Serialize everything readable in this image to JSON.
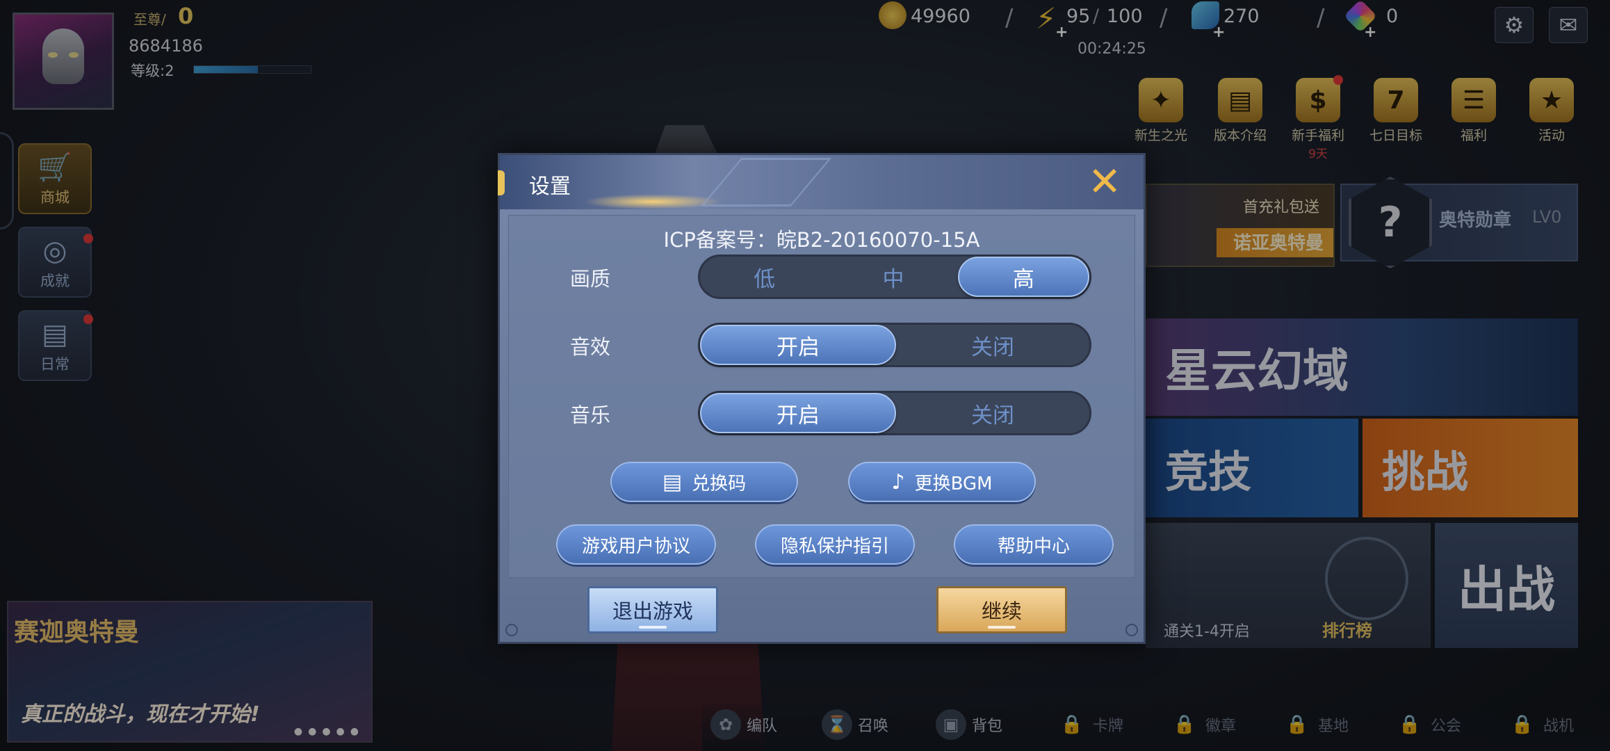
{
  "player": {
    "vip_label": "至尊/",
    "vip_value": "0",
    "id": "8684186",
    "level_label": "等级:2",
    "level_progress": 0.55
  },
  "side_buttons": [
    {
      "label": "商城",
      "icon": "cart-icon"
    },
    {
      "label": "成就",
      "icon": "medal-icon"
    },
    {
      "label": "日常",
      "icon": "daily-icon"
    }
  ],
  "resources": {
    "gold": "49960",
    "energy": "95",
    "energy_max": "100",
    "diamond": "270",
    "gem": "0",
    "timer": "00:24:25"
  },
  "events": [
    {
      "label": "新生之光",
      "icon": "star-burst-icon",
      "sub": ""
    },
    {
      "label": "版本介绍",
      "icon": "scroll-icon",
      "sub": ""
    },
    {
      "label": "新手福利",
      "icon": "coin-icon",
      "sub": "9天"
    },
    {
      "label": "七日目标",
      "icon": "calendar-icon",
      "sub": ""
    },
    {
      "label": "福利",
      "icon": "gift-icon",
      "sub": ""
    },
    {
      "label": "活动",
      "icon": "event-star-icon",
      "sub": ""
    }
  ],
  "promo": {
    "title": "首充礼包送",
    "name": "诺亚奥特曼"
  },
  "medal": {
    "name": "奥特勋章",
    "level": "LV0",
    "symbol": "?"
  },
  "modes": {
    "nebula": "星云幻域",
    "arena": "竞技",
    "challenge": "挑战",
    "battle": "出战",
    "stage_text": "通关1-4开启",
    "rank_text": "排行榜"
  },
  "banner": {
    "title": "赛迦奥特曼",
    "subtitle": "真正的战斗，现在才开始!"
  },
  "bottom_nav": [
    {
      "label": "编队",
      "locked": false
    },
    {
      "label": "召唤",
      "locked": false
    },
    {
      "label": "背包",
      "locked": false
    },
    {
      "label": "卡牌",
      "locked": true
    },
    {
      "label": "徽章",
      "locked": true
    },
    {
      "label": "基地",
      "locked": true
    },
    {
      "label": "公会",
      "locked": true
    },
    {
      "label": "战机",
      "locked": true
    }
  ],
  "dialog": {
    "title": "设置",
    "icp": "ICP备案号：皖B2-20160070-15A",
    "quality": {
      "label": "画质",
      "options": [
        "低",
        "中",
        "高"
      ],
      "selected": "高"
    },
    "sound": {
      "label": "音效",
      "options": [
        "开启",
        "关闭"
      ],
      "selected": "开启"
    },
    "music": {
      "label": "音乐",
      "options": [
        "开启",
        "关闭"
      ],
      "selected": "开启"
    },
    "redeem_label": "兑换码",
    "bgm_label": "更换BGM",
    "user_agreement": "游戏用户协议",
    "privacy": "隐私保护指引",
    "help": "帮助中心",
    "exit": "退出游戏",
    "continue": "继续"
  },
  "colors": {
    "accent_gold": "#e7c35a",
    "toggle_active": "#4d74b8",
    "toggle_track": "#3b4559"
  }
}
